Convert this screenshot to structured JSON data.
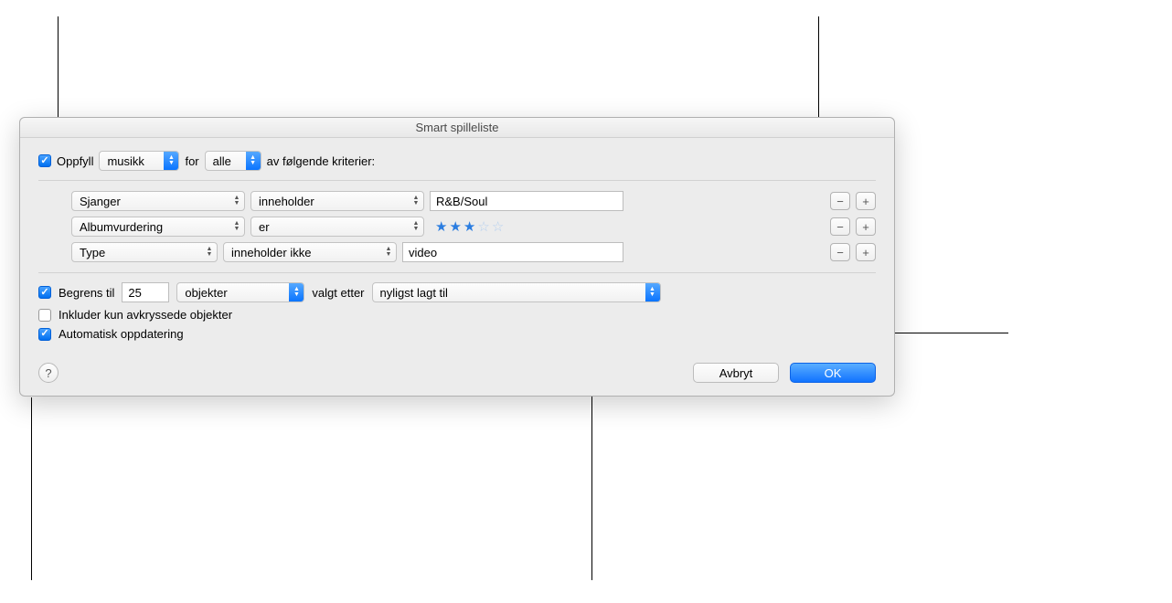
{
  "title": "Smart spilleliste",
  "match": {
    "label_match": "Oppfyll",
    "media_type": "musikk",
    "label_for": "for",
    "all_any": "alle",
    "label_following": "av følgende kriterier:"
  },
  "rules": [
    {
      "field": "Sjanger",
      "operator": "inneholder",
      "value": "R&B/Soul",
      "value_type": "text"
    },
    {
      "field": "Albumvurdering",
      "operator": "er",
      "value": 3,
      "value_type": "stars"
    },
    {
      "field": "Type",
      "operator": "inneholder ikke",
      "value": "video",
      "value_type": "text"
    }
  ],
  "limit": {
    "enabled": true,
    "label": "Begrens til",
    "count": "25",
    "unit": "objekter",
    "label_selected_by": "valgt etter",
    "selected_by": "nyligst lagt til"
  },
  "only_checked": {
    "enabled": false,
    "label": "Inkluder kun avkryssede objekter"
  },
  "live_updating": {
    "enabled": true,
    "label": "Automatisk oppdatering"
  },
  "buttons": {
    "cancel": "Avbryt",
    "ok": "OK",
    "help": "?"
  }
}
